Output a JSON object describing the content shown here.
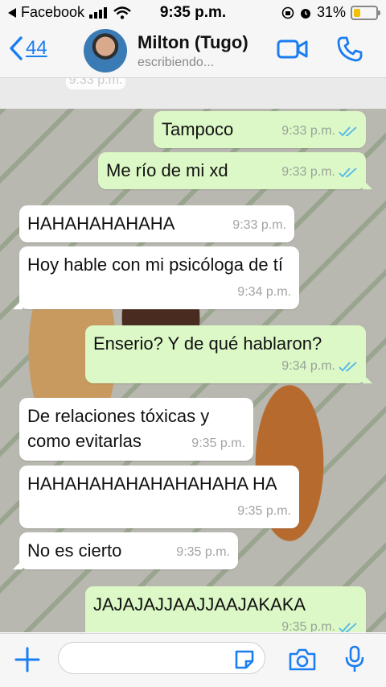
{
  "status_bar": {
    "back_app": "Facebook",
    "time": "9:35 p.m.",
    "battery_text": "31%",
    "battery_level": 0.31
  },
  "header": {
    "back_count": "44",
    "contact_name": "Milton (Tugo)",
    "contact_status": "escribiendo..."
  },
  "chat": {
    "partial_stamp": "9:33 p.m.",
    "messages": [
      {
        "dir": "out",
        "text": "Tampoco",
        "time": "9:33 p.m.",
        "read": true
      },
      {
        "dir": "out",
        "text": "Me río de mi xd",
        "time": "9:33 p.m.",
        "read": true
      },
      {
        "dir": "in",
        "text": "HAHAHAHAHAHA",
        "time": "9:33 p.m."
      },
      {
        "dir": "in",
        "text": "Hoy hable con mi psicóloga de tí",
        "time": "9:34 p.m."
      },
      {
        "dir": "out",
        "text": "Enserio? Y de qué hablaron?",
        "time": "9:34 p.m.",
        "read": true
      },
      {
        "dir": "in",
        "text": "De relaciones tóxicas y como evitarlas",
        "time": "9:35 p.m."
      },
      {
        "dir": "in",
        "text": "HAHAHAHAHAHAHAHAHA HA",
        "time": "9:35 p.m."
      },
      {
        "dir": "in",
        "text": "No es cierto",
        "time": "9:35 p.m."
      },
      {
        "dir": "out",
        "text": "JAJAJAJJAAJJAAJAKAKA",
        "time": "9:35 p.m.",
        "read": true
      }
    ]
  },
  "input_bar": {
    "placeholder": ""
  },
  "colors": {
    "accent": "#1a7df2",
    "outgoing_bubble": "#dcf8c6",
    "incoming_bubble": "#ffffff",
    "read_ticks": "#4fb6ec"
  }
}
